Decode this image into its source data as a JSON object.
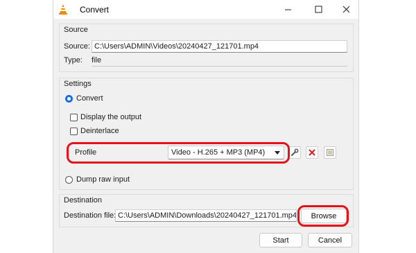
{
  "window": {
    "title": "Convert",
    "app_icon": "vlc-cone-icon",
    "controls": {
      "minimize": "minimize-icon",
      "maximize": "maximize-icon",
      "close": "close-icon"
    }
  },
  "source": {
    "group_title": "Source",
    "source_label": "Source:",
    "source_value": "C:\\Users\\ADMIN\\Videos\\20240427_121701.mp4",
    "type_label": "Type:",
    "type_value": "file"
  },
  "settings": {
    "group_title": "Settings",
    "convert_label": "Convert",
    "display_output_label": "Display the output",
    "deinterlace_label": "Deinterlace",
    "profile_label": "Profile",
    "profile_value": "Video - H.265 + MP3 (MP4)",
    "dump_raw_label": "Dump raw input"
  },
  "destination": {
    "group_title": "Destination",
    "file_label": "Destination file:",
    "file_value": "C:\\Users\\ADMIN\\Downloads\\20240427_121701.mp4",
    "browse_label": "Browse"
  },
  "footer": {
    "start_label": "Start",
    "cancel_label": "Cancel"
  },
  "colors": {
    "highlight": "#e4131b",
    "radio_selected": "#1f6fd8",
    "delete_icon": "#d4202a"
  }
}
